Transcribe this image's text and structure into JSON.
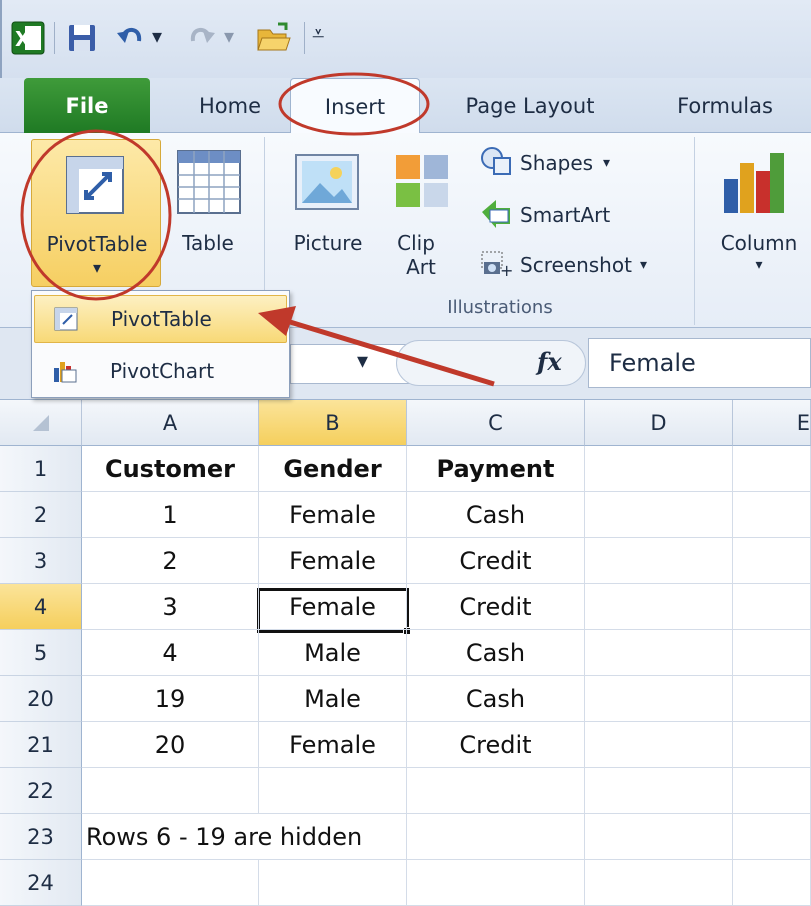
{
  "qat": {
    "app_icon": "excel-icon",
    "undo_arrow": "▾",
    "redo_arrow": "▾",
    "customize": "⇤"
  },
  "tabs": [
    "File",
    "Home",
    "Insert",
    "Page Layout",
    "Formulas"
  ],
  "ribbon": {
    "pivottable_label": "PivotTable",
    "table_label": "Table",
    "picture_label": "Picture",
    "clip_label_1": "Clip",
    "clip_label_2": "Art",
    "shapes_label": "Shapes",
    "smartart_label": "SmartArt",
    "screenshot_label": "Screenshot",
    "column_label": "Column",
    "illustrations_group": "Illustrations",
    "dropdown_arrow": "▾"
  },
  "dropdown": {
    "pivottable": "PivotTable",
    "pivotchart": "PivotChart"
  },
  "formula_bar": {
    "fx": "fx",
    "value": "Female"
  },
  "columns": [
    "A",
    "B",
    "C",
    "D",
    "E"
  ],
  "rows": [
    {
      "num": "1",
      "a": "Customer",
      "b": "Gender",
      "c": "Payment"
    },
    {
      "num": "2",
      "a": "1",
      "b": "Female",
      "c": "Cash"
    },
    {
      "num": "3",
      "a": "2",
      "b": "Female",
      "c": "Credit"
    },
    {
      "num": "4",
      "a": "3",
      "b": "Female",
      "c": "Credit"
    },
    {
      "num": "5",
      "a": "4",
      "b": "Male",
      "c": "Cash"
    },
    {
      "num": "20",
      "a": "19",
      "b": "Male",
      "c": "Cash"
    },
    {
      "num": "21",
      "a": "20",
      "b": "Female",
      "c": "Credit"
    },
    {
      "num": "22",
      "a": "",
      "b": "",
      "c": ""
    },
    {
      "num": "23",
      "a": "Rows 6 - 19 are hidden",
      "b": "",
      "c": ""
    },
    {
      "num": "24",
      "a": "",
      "b": "",
      "c": ""
    }
  ],
  "colors": {
    "annotation_red": "#c0392b",
    "selected_header": "#f5cf5d",
    "file_tab": "#2e8a2f"
  }
}
